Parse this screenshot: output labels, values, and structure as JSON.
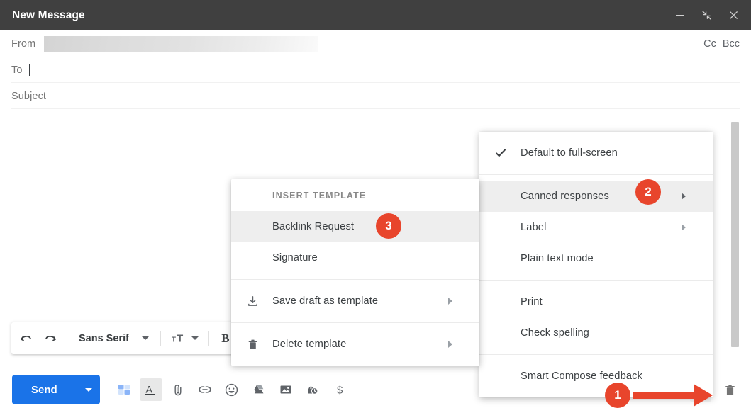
{
  "window": {
    "title": "New Message",
    "controls": [
      {
        "name": "minimize",
        "label": "Minimize"
      },
      {
        "name": "exit-full-screen",
        "label": "Exit full screen"
      },
      {
        "name": "close",
        "label": "Close"
      }
    ]
  },
  "fields": {
    "from_label": "From",
    "from_value_redacted": "",
    "to_label": "To",
    "to_value": "",
    "subject_label": "Subject",
    "subject_value": "",
    "cc_label": "Cc",
    "bcc_label": "Bcc"
  },
  "format_toolbar": {
    "undo_label": "Undo",
    "redo_label": "Redo",
    "font_value": "Sans Serif",
    "size_label": "Size",
    "bold_label": "B"
  },
  "action_bar": {
    "send_label": "Send",
    "send_options_label": "More send options",
    "icons": [
      {
        "name": "templates-icon",
        "label": "Templates"
      },
      {
        "name": "format-text-icon",
        "label": "Formatting options",
        "active": true
      },
      {
        "name": "attach-file-icon",
        "label": "Attach files"
      },
      {
        "name": "insert-link-icon",
        "label": "Insert link"
      },
      {
        "name": "insert-emoji-icon",
        "label": "Insert emoji"
      },
      {
        "name": "google-drive-icon",
        "label": "Insert files using Drive"
      },
      {
        "name": "insert-photo-icon",
        "label": "Insert photo"
      },
      {
        "name": "confidential-mode-icon",
        "label": "Toggle confidential mode"
      },
      {
        "name": "insert-money-icon",
        "label": "Insert money"
      }
    ],
    "more_options_label": "More options",
    "discard_label": "Discard draft"
  },
  "more_menu": {
    "items": [
      {
        "label": "Default to full-screen",
        "checked": true,
        "submenu": false
      },
      {
        "label": "Canned responses",
        "checked": false,
        "submenu": true,
        "highlighted": true,
        "badge": "2"
      },
      {
        "label": "Label",
        "checked": false,
        "submenu": true
      },
      {
        "label": "Plain text mode",
        "checked": false,
        "submenu": false
      },
      {
        "label": "Print",
        "checked": false,
        "submenu": false
      },
      {
        "label": "Check spelling",
        "checked": false,
        "submenu": false
      },
      {
        "label": "Smart Compose feedback",
        "checked": false,
        "submenu": false
      }
    ]
  },
  "canned_responses_menu": {
    "section_title": "INSERT TEMPLATE",
    "templates": [
      {
        "label": "Backlink Request",
        "highlighted": true,
        "badge": "3"
      },
      {
        "label": "Signature",
        "highlighted": false
      }
    ],
    "actions": [
      {
        "label": "Save draft as template",
        "icon": "save-template-icon",
        "submenu": true
      },
      {
        "label": "Delete template",
        "icon": "delete-template-icon",
        "submenu": true
      }
    ]
  },
  "callouts": [
    {
      "number": "1",
      "target": "more-options-button"
    },
    {
      "number": "2",
      "target": "canned-responses-menu-item"
    },
    {
      "number": "3",
      "target": "template-backlink-request"
    }
  ],
  "colors": {
    "titlebar": "#404040",
    "accent_blue": "#1a73e8",
    "callout_orange": "#e8452c",
    "menu_highlight": "#eeeeee"
  }
}
